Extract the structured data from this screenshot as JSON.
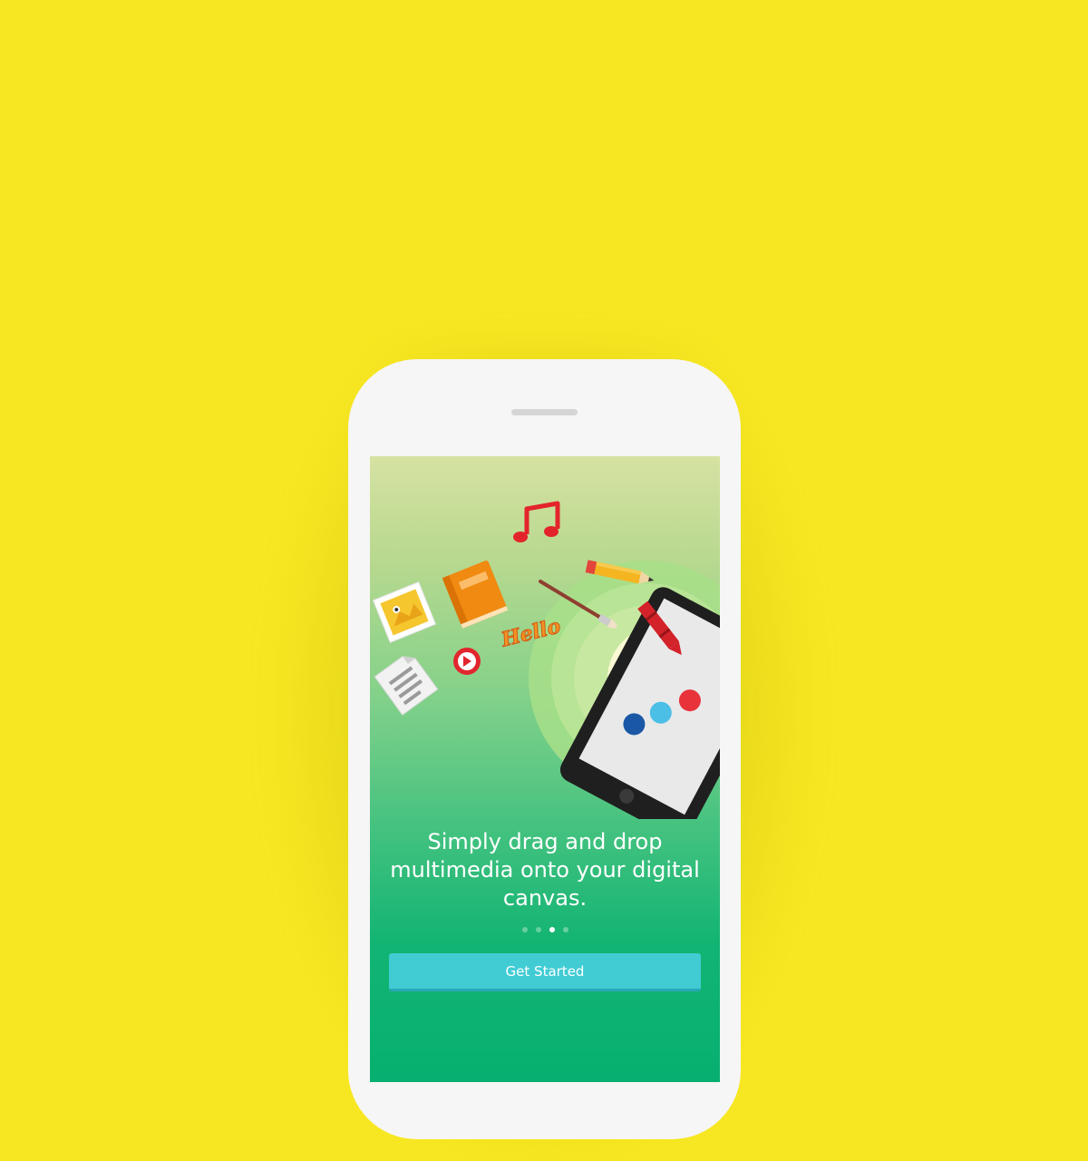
{
  "onboarding": {
    "headline": "Simply drag and drop multimedia onto your digital canvas.",
    "pagination": {
      "total": 4,
      "current": 3
    },
    "cta_label": "Get Started",
    "illustration": {
      "sticker_text": "Hello",
      "items": [
        "photo-icon",
        "book-icon",
        "music-note-icon",
        "pencil-icon",
        "paintbrush-icon",
        "crayon-icon",
        "video-play-icon",
        "document-icon",
        "tablet-device"
      ]
    }
  },
  "colors": {
    "background": "#f7e722",
    "phone_body": "#f6f6f6",
    "cta_background": "#41ccd4",
    "screen_gradient_top": "#d6e2a2",
    "screen_gradient_bottom": "#07b070"
  }
}
